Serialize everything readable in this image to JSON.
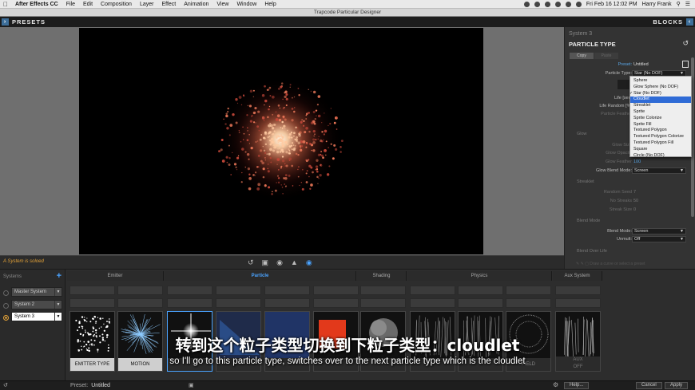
{
  "menubar": {
    "app": "After Effects CC",
    "items": [
      "File",
      "Edit",
      "Composition",
      "Layer",
      "Effect",
      "Animation",
      "View",
      "Window",
      "Help"
    ],
    "clock": "Fri Feb 16  12:02 PM",
    "user": "Harry Frank"
  },
  "window_title": "Trapcode Particular Designer",
  "header": {
    "presets": "PRESETS",
    "blocks": "BLOCKS"
  },
  "status": {
    "message": "A System is soloed"
  },
  "panel": {
    "system": "System 3",
    "title": "PARTICLE TYPE",
    "tabs": [
      "Copy",
      "Paste"
    ],
    "preset_label": "Preset:",
    "preset_value": "Untitled",
    "particle_type_label": "Particle Type:",
    "particle_type_value": "Star (No DOF)",
    "rows": [
      {
        "label": "Life [sec]",
        "value": ""
      },
      {
        "label": "Life Random [%]",
        "value": ""
      },
      {
        "label": "Particle Feather",
        "value": ""
      },
      {
        "label": "Glow",
        "value": ""
      },
      {
        "label": "Glow Size",
        "value": ""
      },
      {
        "label": "Glow Opacity",
        "value": ""
      },
      {
        "label": "Glow Feather",
        "value": "100"
      },
      {
        "label": "Glow Blend Mode:",
        "value": "Screen"
      },
      {
        "label": "Streaklet",
        "value": ""
      },
      {
        "label": "Random Seed",
        "value": "7"
      },
      {
        "label": "No Streaks",
        "value": "50"
      },
      {
        "label": "Streak Size",
        "value": "0"
      },
      {
        "label": "Blend Mode",
        "value": ""
      },
      {
        "label": "Blend Mode:",
        "value": "Screen"
      },
      {
        "label": "Unmult:",
        "value": "Off"
      },
      {
        "label": "Blend Over Life",
        "value": ""
      }
    ],
    "footer_hint": "Draw a curve or select a preset"
  },
  "dropdown": {
    "options": [
      "Sphere",
      "Glow Sphere (No DOF)",
      "Star (No DOF)",
      "Cloudlet",
      "Streaklet",
      "Sprite",
      "Sprite Colorize",
      "Sprite Fill",
      "Textured Polygon",
      "Textured Polygon Colorize",
      "Textured Polygon Fill",
      "Square",
      "Circle (No DOF)"
    ],
    "checked": "Star (No DOF)",
    "highlighted": "Cloudlet"
  },
  "systems_panel": {
    "title": "Systems",
    "items": [
      "Master System",
      "System 2",
      "System 3"
    ],
    "active": "System 3"
  },
  "categories": [
    "Emitter",
    "Particle",
    "Shading",
    "Physics",
    "Aux System"
  ],
  "tiles": [
    "EMITTER TYPE",
    "MOTION",
    "",
    "",
    "",
    "",
    "",
    "",
    "",
    "",
    "FIELD",
    "AUX"
  ],
  "aux_sub": "OFF",
  "footer": {
    "preset_label": "Preset:",
    "preset_value": "Untitled",
    "help": "Help...",
    "cancel": "Cancel",
    "apply": "Apply"
  },
  "subtitles": {
    "zh": "转到这个粒子类型切换到下粒子类型：cloudlet",
    "en": "so I'll go to this particle type, switches over to the next particle type which is the cloudlet"
  },
  "colors": {
    "accent": "#4aa3ff",
    "highlight": "#2f6bd6",
    "warning": "#e3a238"
  }
}
